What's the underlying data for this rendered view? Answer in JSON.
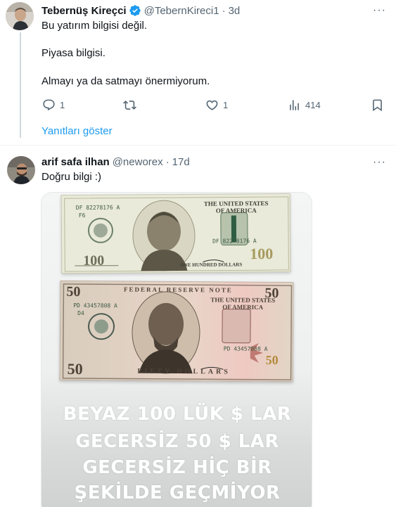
{
  "tweet1": {
    "name": "Tebernüş Kireçci",
    "handle": "@TebernKireci1",
    "dot": "·",
    "time": "3d",
    "lines": [
      "Bu yatırım bilgisi değil.",
      "Piyasa bilgisi.",
      "Almayı ya da satmayı önermiyorum."
    ],
    "actions": {
      "replies": "1",
      "retweets": "",
      "likes": "1",
      "views": "414"
    },
    "show_replies": "Yanıtları göster"
  },
  "tweet2": {
    "name": "arif safa ilhan",
    "handle": "@neworex",
    "dot": "·",
    "time": "17d",
    "text": "Doğru bilgi :)",
    "image": {
      "bill100": {
        "serial": "DF 82278176 A",
        "serial2": "DF 82278176 A",
        "series_letter": "F6",
        "banner": "THE UNITED STATES OF AMERICA",
        "denom": "100",
        "footer": "ONE HUNDRED DOLLARS"
      },
      "bill50": {
        "serial": "PD 43457808 A",
        "serial2": "PD 43457808 A",
        "series_letter": "D4",
        "banner": "THE UNITED STATES OF AMERICA",
        "denom": "50",
        "footer": "FIFTY DOLLARS",
        "header": "FEDERAL RESERVE NOTE"
      },
      "caption_lines": [
        "BEYAZ 100 LÜK $ LAR",
        "GECERSİZ 50 $ LAR",
        "GECERSİZ HİÇ BİR",
        "ŞEKİLDE GEÇMİYOR"
      ]
    }
  },
  "colors": {
    "accent": "#1d9bf0",
    "text": "#0f1419",
    "muted": "#536471",
    "divider": "#eff3f4"
  },
  "icons": [
    "more-icon",
    "verified-badge-icon",
    "reply-icon",
    "retweet-icon",
    "like-icon",
    "views-icon",
    "bookmark-icon"
  ]
}
